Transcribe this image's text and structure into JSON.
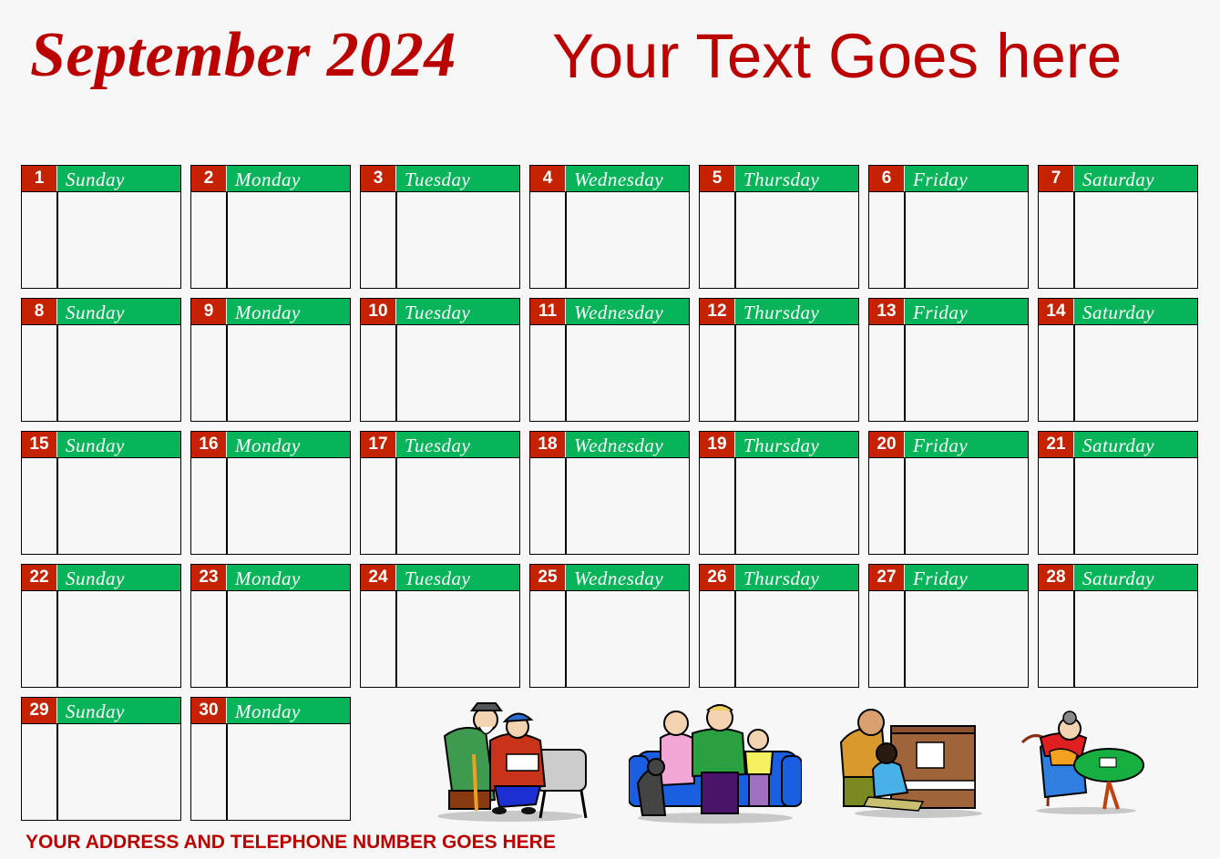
{
  "header": {
    "month_year": "September 2024",
    "custom_text": "Your Text Goes here"
  },
  "colors": {
    "title_red": "#bb0000",
    "day_number_bg": "#c42200",
    "weekday_header_bg": "#08b45a",
    "background": "#f7f7f7"
  },
  "calendar": {
    "days": [
      {
        "num": "1",
        "name": "Sunday"
      },
      {
        "num": "2",
        "name": "Monday"
      },
      {
        "num": "3",
        "name": "Tuesday"
      },
      {
        "num": "4",
        "name": "Wednesday"
      },
      {
        "num": "5",
        "name": "Thursday"
      },
      {
        "num": "6",
        "name": "Friday"
      },
      {
        "num": "7",
        "name": "Saturday"
      },
      {
        "num": "8",
        "name": "Sunday"
      },
      {
        "num": "9",
        "name": "Monday"
      },
      {
        "num": "10",
        "name": "Tuesday"
      },
      {
        "num": "11",
        "name": "Wednesday"
      },
      {
        "num": "12",
        "name": "Thursday"
      },
      {
        "num": "13",
        "name": "Friday"
      },
      {
        "num": "14",
        "name": "Saturday"
      },
      {
        "num": "15",
        "name": "Sunday"
      },
      {
        "num": "16",
        "name": "Monday"
      },
      {
        "num": "17",
        "name": "Tuesday"
      },
      {
        "num": "18",
        "name": "Wednesday"
      },
      {
        "num": "19",
        "name": "Thursday"
      },
      {
        "num": "20",
        "name": "Friday"
      },
      {
        "num": "21",
        "name": "Saturday"
      },
      {
        "num": "22",
        "name": "Sunday"
      },
      {
        "num": "23",
        "name": "Monday"
      },
      {
        "num": "24",
        "name": "Tuesday"
      },
      {
        "num": "25",
        "name": "Wednesday"
      },
      {
        "num": "26",
        "name": "Thursday"
      },
      {
        "num": "27",
        "name": "Friday"
      },
      {
        "num": "28",
        "name": "Saturday"
      },
      {
        "num": "29",
        "name": "Sunday"
      },
      {
        "num": "30",
        "name": "Monday"
      }
    ]
  },
  "clipart": [
    {
      "icon": "elderly-couple-on-bench-icon"
    },
    {
      "icon": "family-on-sofa-icon"
    },
    {
      "icon": "piano-lesson-icon"
    },
    {
      "icon": "grandma-playing-cards-icon"
    }
  ],
  "footer": {
    "address_text": "YOUR ADDRESS AND TELEPHONE NUMBER GOES HERE"
  }
}
